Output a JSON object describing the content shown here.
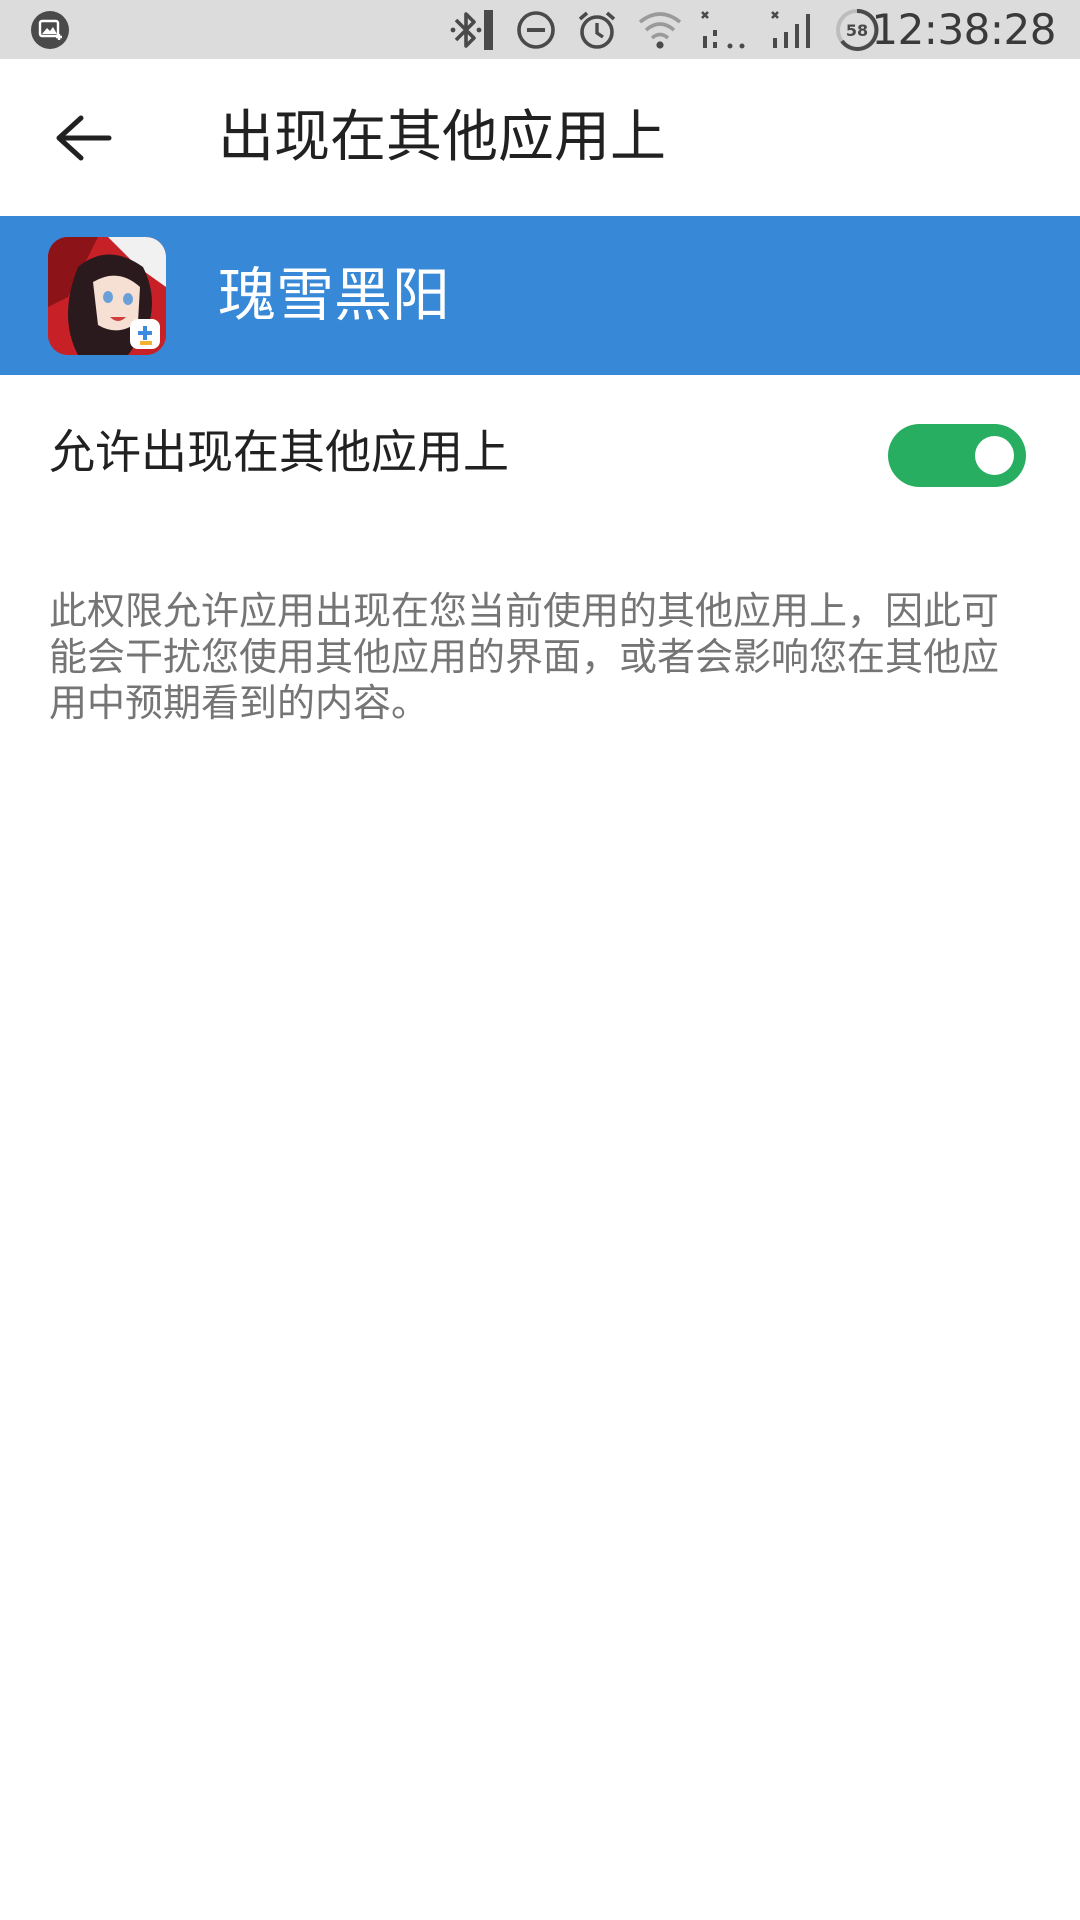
{
  "status_bar": {
    "time": "12:38:28",
    "battery_level": "58",
    "icons": [
      "screenshot-notification-icon",
      "bluetooth-icon",
      "do-not-disturb-icon",
      "alarm-icon",
      "wifi-icon",
      "no-signal-icon",
      "cell-signal-icon",
      "battery-icon"
    ]
  },
  "app_bar": {
    "title": "出现在其他应用上",
    "back_icon": "arrow-back-icon"
  },
  "app_header": {
    "app_name": "瑰雪黑阳",
    "background_color": "#3789d8"
  },
  "setting": {
    "label": "允许出现在其他应用上",
    "enabled": true,
    "toggle_color": "#27ae60"
  },
  "description": "此权限允许应用出现在您当前使用的其他应用上，因此可能会干扰您使用其他应用的界面，或者会影响您在其他应用中预期看到的内容。"
}
